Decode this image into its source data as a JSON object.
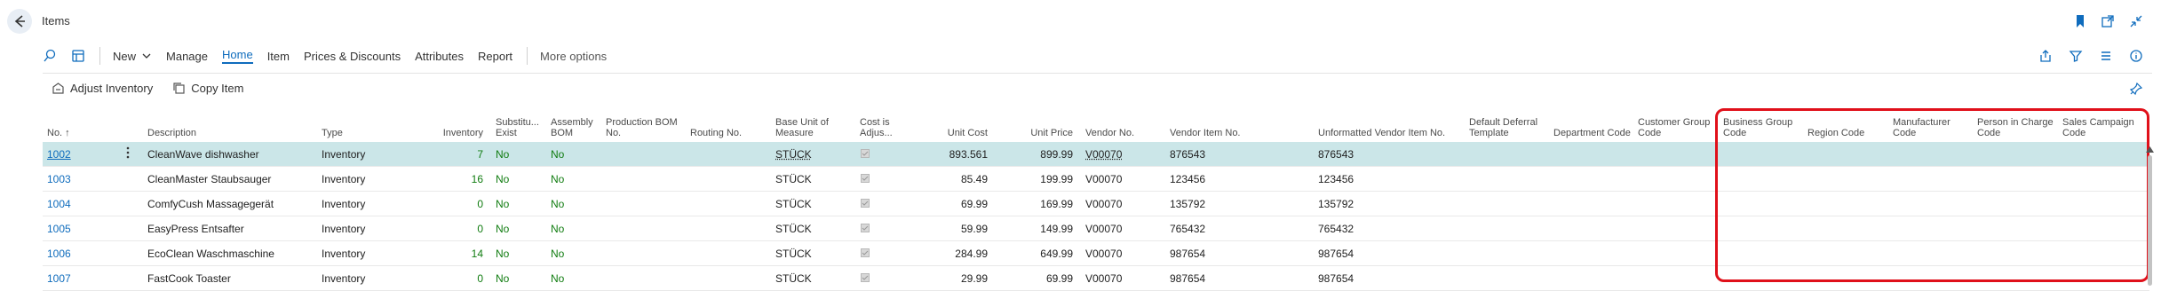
{
  "page": {
    "title": "Items"
  },
  "actions": {
    "new": "New",
    "manage": "Manage",
    "home": "Home",
    "item": "Item",
    "prices": "Prices & Discounts",
    "attributes": "Attributes",
    "report": "Report",
    "more": "More options"
  },
  "subactions": {
    "adjust": "Adjust Inventory",
    "copy": "Copy Item"
  },
  "columns": {
    "no": "No. ↑",
    "description": "Description",
    "type": "Type",
    "inventory": "Inventory",
    "subst1": "Substitu...",
    "subst2": "Exist",
    "assembly1": "Assembly",
    "assembly2": "BOM",
    "prodbom1": "Production BOM",
    "prodbom2": "No.",
    "routing": "Routing No.",
    "baseunit1": "Base Unit of",
    "baseunit2": "Measure",
    "costadj1": "Cost is",
    "costadj2": "Adjus...",
    "unitcost": "Unit Cost",
    "unitprice": "Unit Price",
    "vendorno": "Vendor No.",
    "vendoritem": "Vendor Item No.",
    "unformatted": "Unformatted Vendor Item No.",
    "deferral1": "Default Deferral",
    "deferral2": "Template",
    "dept": "Department Code",
    "custgroup1": "Customer Group",
    "custgroup2": "Code",
    "busgroup1": "Business Group",
    "busgroup2": "Code",
    "region": "Region Code",
    "manufacturer1": "Manufacturer",
    "manufacturer2": "Code",
    "person1": "Person in Charge",
    "person2": "Code",
    "campaign1": "Sales Campaign",
    "campaign2": "Code"
  },
  "rows": [
    {
      "no": "1002",
      "description": "CleanWave dishwasher",
      "type": "Inventory",
      "inventory": "7",
      "subst": "No",
      "assembly": "No",
      "unit": "STÜCK",
      "unit_cost": "893.561",
      "unit_price": "899.99",
      "vendor_no": "V00070",
      "vendor_item": "876543",
      "unformatted": "876543"
    },
    {
      "no": "1003",
      "description": "CleanMaster Staubsauger",
      "type": "Inventory",
      "inventory": "16",
      "subst": "No",
      "assembly": "No",
      "unit": "STÜCK",
      "unit_cost": "85.49",
      "unit_price": "199.99",
      "vendor_no": "V00070",
      "vendor_item": "123456",
      "unformatted": "123456"
    },
    {
      "no": "1004",
      "description": "ComfyCush Massagegerät",
      "type": "Inventory",
      "inventory": "0",
      "subst": "No",
      "assembly": "No",
      "unit": "STÜCK",
      "unit_cost": "69.99",
      "unit_price": "169.99",
      "vendor_no": "V00070",
      "vendor_item": "135792",
      "unformatted": "135792"
    },
    {
      "no": "1005",
      "description": "EasyPress Entsafter",
      "type": "Inventory",
      "inventory": "0",
      "subst": "No",
      "assembly": "No",
      "unit": "STÜCK",
      "unit_cost": "59.99",
      "unit_price": "149.99",
      "vendor_no": "V00070",
      "vendor_item": "765432",
      "unformatted": "765432"
    },
    {
      "no": "1006",
      "description": "EcoClean Waschmaschine",
      "type": "Inventory",
      "inventory": "14",
      "subst": "No",
      "assembly": "No",
      "unit": "STÜCK",
      "unit_cost": "284.99",
      "unit_price": "649.99",
      "vendor_no": "V00070",
      "vendor_item": "987654",
      "unformatted": "987654"
    },
    {
      "no": "1007",
      "description": "FastCook Toaster",
      "type": "Inventory",
      "inventory": "0",
      "subst": "No",
      "assembly": "No",
      "unit": "STÜCK",
      "unit_cost": "29.99",
      "unit_price": "69.99",
      "vendor_no": "V00070",
      "vendor_item": "987654",
      "unformatted": "987654"
    }
  ],
  "colors": {
    "accent": "#0f6cbd",
    "positive": "#107c10",
    "selected_row": "#cbe6e8",
    "highlight_box": "#e0101a"
  }
}
